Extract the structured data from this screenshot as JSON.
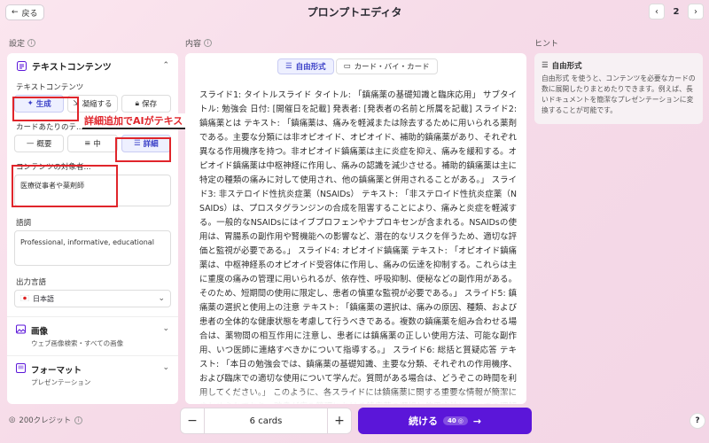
{
  "header": {
    "back_label": "戻る",
    "title": "プロンプトエディタ",
    "page_number": "2"
  },
  "columns": {
    "settings": "設定",
    "content": "内容",
    "hint": "ヒント"
  },
  "left": {
    "text_content_title": "テキストコンテンツ",
    "text_content_label": "テキストコンテンツ",
    "mode_buttons": [
      "生成",
      "凝縮する",
      "保存"
    ],
    "per_card_label": "カードあたりのテ...",
    "detail_buttons": [
      "概要",
      "中",
      "詳細"
    ],
    "audience_label": "コンテンツの対象者...",
    "audience_value": "医療従事者や薬剤師",
    "tone_label": "語調",
    "tone_value": "Professional, informative, educational",
    "output_lang_label": "出力言語",
    "output_lang_value": "日本語",
    "image_title": "画像",
    "image_sub": "ウェブ画像検索・すべての画像",
    "format_title": "フォーマット",
    "format_sub": "プレゼンテーション"
  },
  "annotation": {
    "text": "詳細追加でAIがテキスト生成"
  },
  "middle": {
    "tabs": [
      "自由形式",
      "カード・バイ・カード"
    ],
    "body": "スライド1: タイトルスライド タイトル: 「鎮痛薬の基礎知識と臨床応用」 サブタイトル: 勉強会 日付: [開催日を記載] 発表者: [発表者の名前と所属を記載] スライド2: 鎮痛薬とは テキスト: 「鎮痛薬は、痛みを軽減または除去するために用いられる薬剤である。主要な分類には非オピオイド、オピオイド、補助的鎮痛薬があり、それぞれ異なる作用機序を持つ。非オピオイド鎮痛薬は主に炎症を抑え、痛みを緩和する。オピオイド鎮痛薬は中枢神経に作用し、痛みの認識を減少させる。補助的鎮痛薬は主に特定の種類の痛みに対して使用され、他の鎮痛薬と併用されることがある。」 スライド3: 非ステロイド性抗炎症薬（NSAIDs） テキスト: 「非ステロイド性抗炎症薬（NSAIDs）は、プロスタグランジンの合成を阻害することにより、痛みと炎症を軽減する。一般的なNSAIDsにはイブプロフェンやナプロキセンが含まれる。NSAIDsの使用は、胃腸系の副作用や腎機能への影響など、潜在的なリスクを伴うため、適切な評価と監視が必要である。」 スライド4: オピオイド鎮痛薬 テキスト: 「オピオイド鎮痛薬は、中枢神経系のオピオイド受容体に作用し、痛みの伝達を抑制する。これらは主に重度の痛みの管理に用いられるが、依存性、呼吸抑制、便秘などの副作用がある。そのため、短期間の使用に限定し、患者の慎重な監視が必要である。」 スライド5: 鎮痛薬の選択と使用上の注意 テキスト: 「鎮痛薬の選択は、痛みの原因、種類、および患者の全体的な健康状態を考慮して行うべきである。複数の鎮痛薬を組み合わせる場合は、薬物間の相互作用に注意し、患者には鎮痛薬の正しい使用方法、可能な副作用、いつ医師に連絡すべきかについて指導する。」 スライド6: 総括と質疑応答 テキスト: 「本日の勉強会では、鎮痛薬の基礎知識、主要な分類、それぞれの作用機序、および臨床での適切な使用について学んだ。質問がある場合は、どうぞこの時間を利用してください。」 このように、各スライドには鎮痛薬に関する重要な情報が簡潔にまとめられており、聴衆が痛み管理における鎮痛薬の選択と使用方法についての理解を深めることができるように設計されています。"
  },
  "hint": {
    "title": "自由形式",
    "body": "自由形式 を使うと、コンテンツを必要なカードの数に展開したりまとめたりできます。例えば、長いドキュメントを簡潔なプレゼンテーションに変換することが可能です。"
  },
  "footer": {
    "credits": "200クレジット",
    "card_count": "6 cards",
    "minus": "−",
    "plus": "+",
    "continue_label": "続ける",
    "cost": "40",
    "help": "?"
  },
  "icons": {
    "back": "arrow-left-icon",
    "prev": "chevron-left-icon",
    "next": "chevron-right-icon",
    "generate": "sparkle-icon",
    "condense": "shrink-icon",
    "preserve": "lock-icon",
    "image": "image-icon",
    "format": "format-icon",
    "flag": "flag-icon"
  },
  "colors": {
    "accent": "#5b16d9",
    "highlight": "#e0252b",
    "active_tab_bg": "#eef0ff",
    "active_tab_fg": "#3a3fc7"
  }
}
